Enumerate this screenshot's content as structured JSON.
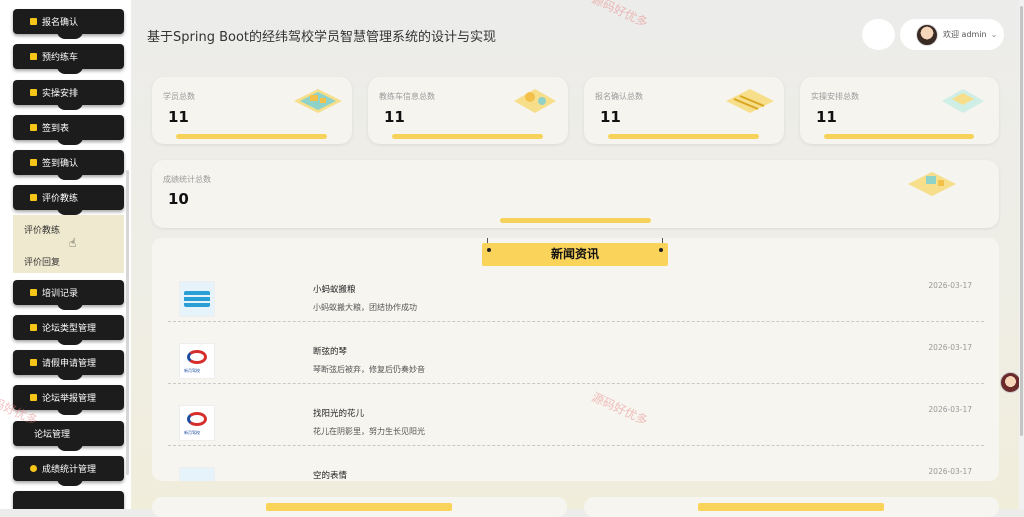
{
  "sidebar": {
    "menu": [
      {
        "label": "报名确认",
        "icon": "clipboard-icon"
      },
      {
        "label": "预约练车",
        "icon": "calendar-icon"
      },
      {
        "label": "实操安排",
        "icon": "schedule-icon"
      },
      {
        "label": "签到表",
        "icon": "checkin-icon"
      },
      {
        "label": "签到确认",
        "icon": "confirm-icon"
      },
      {
        "label": "评价教练",
        "icon": "review-icon"
      },
      {
        "label": "培训记录",
        "icon": "record-icon"
      },
      {
        "label": "论坛类型管理",
        "icon": "folder-icon"
      },
      {
        "label": "请假申请管理",
        "icon": "leave-icon"
      },
      {
        "label": "论坛举报管理",
        "icon": "report-icon"
      },
      {
        "label": "论坛管理",
        "icon": ""
      },
      {
        "label": "成绩统计管理",
        "icon": "stats-icon"
      }
    ],
    "submenu": [
      "评价教练",
      "评价回复"
    ]
  },
  "header": {
    "title": "基于Spring Boot的经纬驾校学员智慧管理系统的设计与实现",
    "welcome": "欢迎 admin"
  },
  "stats": [
    {
      "label": "学员总数",
      "value": "11"
    },
    {
      "label": "教练车信息总数",
      "value": "11"
    },
    {
      "label": "报名确认总数",
      "value": "11"
    },
    {
      "label": "实操安排总数",
      "value": "11"
    },
    {
      "label": "成绩统计总数",
      "value": "10"
    }
  ],
  "news": {
    "heading": "新闻资讯",
    "items": [
      {
        "title": "小蚂蚁搬粮",
        "desc": "小蚂蚁搬大粮，团结协作成功",
        "date": "2026-03-17"
      },
      {
        "title": "断弦的琴",
        "desc": "琴断弦后被弃，修复后仍奏妙音",
        "date": "2026-03-17"
      },
      {
        "title": "找阳光的花儿",
        "desc": "花儿在阴影里，努力生长见阳光",
        "date": "2026-03-17"
      },
      {
        "title": "空的表情",
        "desc": "",
        "date": "2026-03-17"
      }
    ]
  },
  "watermark": "源码好优多",
  "colors": {
    "accent": "#fad35a",
    "menu_bg": "#1c1c1c",
    "icon": "#f5c518"
  }
}
